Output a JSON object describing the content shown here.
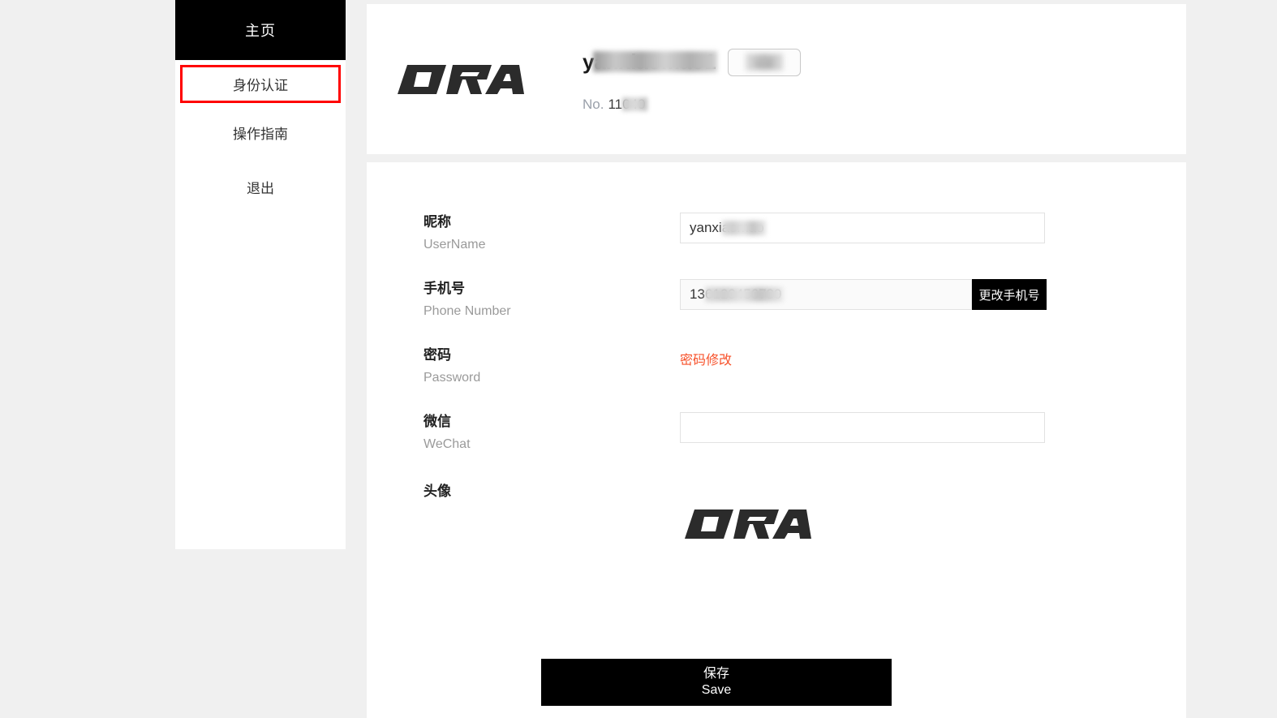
{
  "brand": {
    "logo_text": "DRA",
    "logo_name": "dra-logo"
  },
  "sidebar": {
    "header_label": "主页",
    "items": [
      {
        "label": "身份认证",
        "active": true
      },
      {
        "label": "操作指南",
        "active": false
      },
      {
        "label": "退出",
        "active": false
      }
    ]
  },
  "profile": {
    "username_visible": "y",
    "username_redacted": "anxiaomao1",
    "badge_text": "认证",
    "no_label": "No.",
    "no_visible": "11",
    "no_redacted": "040"
  },
  "form": {
    "rows": [
      {
        "label_cn": "昵称",
        "label_en": "UserName",
        "type": "input",
        "value_visible": "yanxi",
        "value_redacted": "aomao"
      },
      {
        "label_cn": "手机号",
        "label_en": "Phone Number",
        "type": "input_with_button",
        "value_visible": "13",
        "value_redacted": "6123456789",
        "button_label": "更改手机号"
      },
      {
        "label_cn": "密码",
        "label_en": "Password",
        "type": "link",
        "link_label": "密码修改"
      },
      {
        "label_cn": "微信",
        "label_en": "WeChat",
        "type": "input",
        "value_visible": "",
        "value_redacted": ""
      },
      {
        "label_cn": "头像",
        "label_en": "",
        "type": "avatar"
      }
    ]
  },
  "save_button": {
    "label_cn": "保存",
    "label_en": "Save"
  },
  "colors": {
    "page_background": "#f0f0f0",
    "panel": "#ffffff",
    "accent_black": "#000000",
    "highlight_red": "#ff0000",
    "link_orange": "#f7512a",
    "label_muted": "#9a9a9a"
  }
}
